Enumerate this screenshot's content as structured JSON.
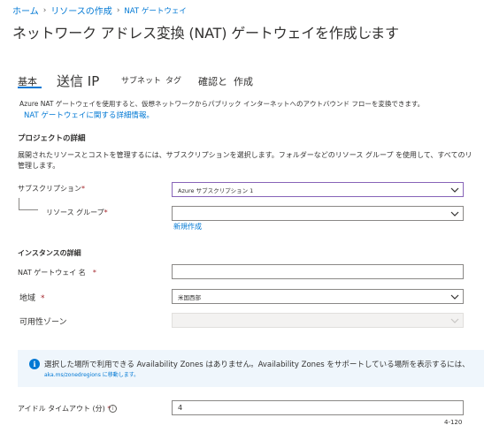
{
  "breadcrumb": {
    "home": "ホーム",
    "create_resource": "リソースの作成",
    "nat_gateway": "NAT ゲートウェイ"
  },
  "page": {
    "title": "ネットワーク アドレス変換 (NAT) ゲートウェイを作成します",
    "more": "…"
  },
  "tabs": [
    {
      "label": "基本",
      "active": true
    },
    {
      "label": "送信 IP"
    },
    {
      "label": "サブネット"
    },
    {
      "label": "タグ"
    },
    {
      "label": "確認と"
    },
    {
      "label": "作成"
    }
  ],
  "intro": {
    "description": "Azure NAT ゲートウェイを使用すると、仮想ネットワークからパブリック インターネットへのアウトバウンド フローを変換できます。",
    "link": "NAT ゲートウェイに関する詳細情報。"
  },
  "project": {
    "heading": "プロジェクトの詳細",
    "description_line1": "展開されたリソースとコストを管理するには、サブスクリプションを選択します。フォルダーなどのリソース グループ を使用して、すべてのリ",
    "description_line2": "管理します。",
    "subscription_label": "サブスクリプション",
    "subscription_value": "Azure サブスクリプション 1",
    "resource_group_label": "リソース グループ",
    "resource_group_value": "",
    "create_new": "新規作成"
  },
  "instance": {
    "heading": "インスタンスの詳細",
    "name_label": "NAT ゲートウェイ 名",
    "name_value": "",
    "region_label": "地域",
    "region_value": "米国西部",
    "zone_label": "可用性ゾーン",
    "zone_value": ""
  },
  "info": {
    "text": "選択した場所で利用できる Availability Zones はありません。Availability Zones をサポートしている場所を表示するには、",
    "link": "aka.ms/zonedregions に移動します。"
  },
  "timeout": {
    "label": "アイドル タイムアウト (分)",
    "value": "4",
    "range": "4-120"
  },
  "colors": {
    "accent": "#0078d4",
    "required": "#a4262c",
    "focus_border": "#8764b8",
    "info_bg": "#eff6fc"
  }
}
